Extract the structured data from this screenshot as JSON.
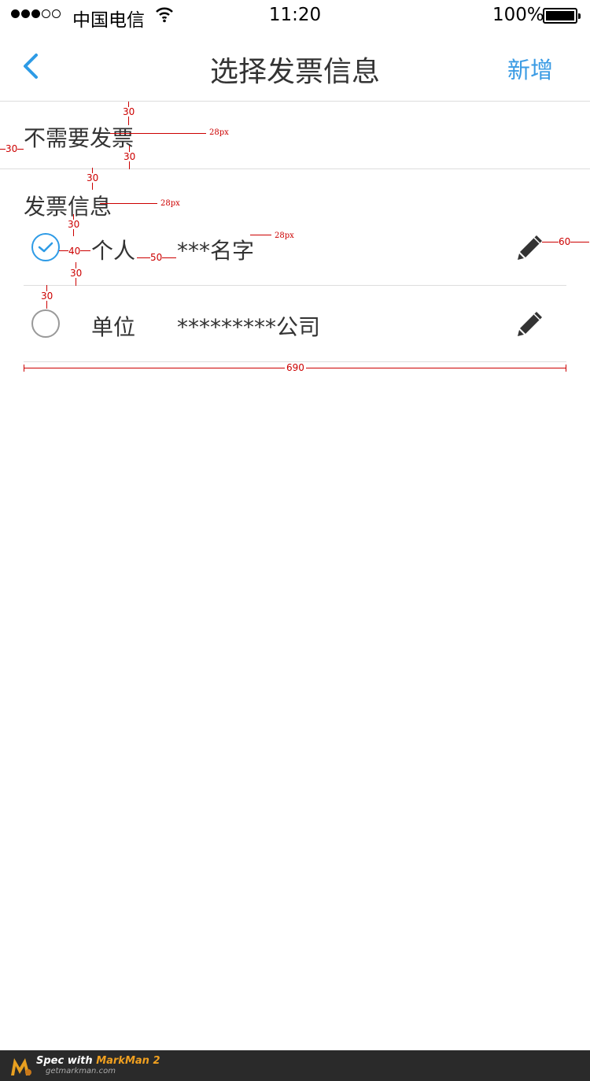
{
  "status_bar": {
    "carrier": "中国电信",
    "time": "11:20",
    "battery_pct": "100%",
    "signal_bars": 3
  },
  "nav": {
    "title": "选择发票信息",
    "add_label": "新增"
  },
  "no_invoice_label": "不需要发票",
  "invoice_info_label": "发票信息",
  "invoices": [
    {
      "type": "个人",
      "name": "***名字",
      "selected": true
    },
    {
      "type": "单位",
      "name": "*********公司",
      "selected": false
    }
  ],
  "annotations": {
    "a30_1": "30",
    "a28_1": "28px",
    "a30_left": "30",
    "a30_2": "30",
    "a30_3": "30",
    "a28_2": "28px",
    "a30_4": "30",
    "a40": "40",
    "a50": "50",
    "a28_3": "28px",
    "a60": "60",
    "a30_5": "30",
    "a30_6": "30",
    "a690": "690"
  },
  "footer": {
    "brand_prefix": "Spec with ",
    "brand": "MarkMan 2",
    "url": "getmarkman.com"
  },
  "colors": {
    "accent": "#2e9be6",
    "annotation": "#cc0000"
  }
}
